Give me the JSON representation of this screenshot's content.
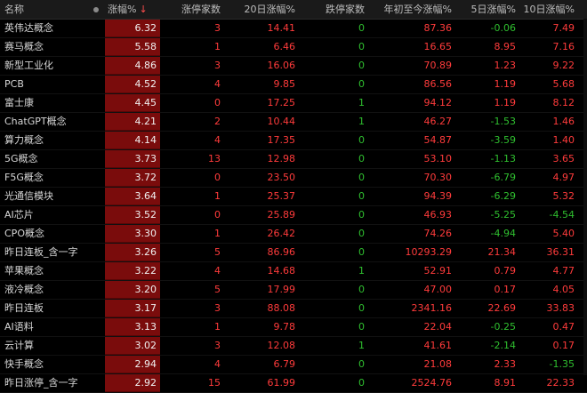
{
  "header": {
    "name": "名称",
    "pct": "涨幅%",
    "sort_icon": "↓",
    "limit_up": "涨停家数",
    "d20": "20日涨幅%",
    "limit_down": "跌停家数",
    "ytd": "年初至今涨幅%",
    "d5": "5日涨幅%",
    "d10": "10日涨幅%"
  },
  "colors": {
    "up": "#ff3b3b",
    "down": "#2fbf2f",
    "pct_bg": "#7a0c0c"
  },
  "rows": [
    {
      "name": "英伟达概念",
      "pct": "6.32",
      "limit_up": "3",
      "d20": "14.41",
      "limit_down": "0",
      "ytd": "87.36",
      "d5": "-0.06",
      "d10": "7.49"
    },
    {
      "name": "赛马概念",
      "pct": "5.58",
      "limit_up": "1",
      "d20": "6.46",
      "limit_down": "0",
      "ytd": "16.65",
      "d5": "8.95",
      "d10": "7.16"
    },
    {
      "name": "新型工业化",
      "pct": "4.86",
      "limit_up": "3",
      "d20": "16.06",
      "limit_down": "0",
      "ytd": "70.89",
      "d5": "1.23",
      "d10": "9.22"
    },
    {
      "name": "PCB",
      "pct": "4.52",
      "limit_up": "4",
      "d20": "9.85",
      "limit_down": "0",
      "ytd": "86.56",
      "d5": "1.19",
      "d10": "5.68"
    },
    {
      "name": "富士康",
      "pct": "4.45",
      "limit_up": "0",
      "d20": "17.25",
      "limit_down": "1",
      "ytd": "94.12",
      "d5": "1.19",
      "d10": "8.12"
    },
    {
      "name": "ChatGPT概念",
      "pct": "4.21",
      "limit_up": "2",
      "d20": "10.44",
      "limit_down": "1",
      "ytd": "46.27",
      "d5": "-1.53",
      "d10": "1.46"
    },
    {
      "name": "算力概念",
      "pct": "4.14",
      "limit_up": "4",
      "d20": "17.35",
      "limit_down": "0",
      "ytd": "54.87",
      "d5": "-3.59",
      "d10": "1.40"
    },
    {
      "name": "5G概念",
      "pct": "3.73",
      "limit_up": "13",
      "d20": "12.98",
      "limit_down": "0",
      "ytd": "53.10",
      "d5": "-1.13",
      "d10": "3.65"
    },
    {
      "name": "F5G概念",
      "pct": "3.72",
      "limit_up": "0",
      "d20": "23.50",
      "limit_down": "0",
      "ytd": "70.30",
      "d5": "-6.79",
      "d10": "4.97"
    },
    {
      "name": "光通信模块",
      "pct": "3.64",
      "limit_up": "1",
      "d20": "25.37",
      "limit_down": "0",
      "ytd": "94.39",
      "d5": "-6.29",
      "d10": "5.32"
    },
    {
      "name": "AI芯片",
      "pct": "3.52",
      "limit_up": "0",
      "d20": "25.89",
      "limit_down": "0",
      "ytd": "46.93",
      "d5": "-5.25",
      "d10": "-4.54"
    },
    {
      "name": "CPO概念",
      "pct": "3.30",
      "limit_up": "1",
      "d20": "26.42",
      "limit_down": "0",
      "ytd": "74.26",
      "d5": "-4.94",
      "d10": "5.40"
    },
    {
      "name": "昨日连板_含一字",
      "pct": "3.26",
      "limit_up": "5",
      "d20": "86.96",
      "limit_down": "0",
      "ytd": "10293.29",
      "d5": "21.34",
      "d10": "36.31"
    },
    {
      "name": "苹果概念",
      "pct": "3.22",
      "limit_up": "4",
      "d20": "14.68",
      "limit_down": "1",
      "ytd": "52.91",
      "d5": "0.79",
      "d10": "4.77"
    },
    {
      "name": "液冷概念",
      "pct": "3.20",
      "limit_up": "5",
      "d20": "17.99",
      "limit_down": "0",
      "ytd": "47.00",
      "d5": "0.17",
      "d10": "4.05"
    },
    {
      "name": "昨日连板",
      "pct": "3.17",
      "limit_up": "3",
      "d20": "88.08",
      "limit_down": "0",
      "ytd": "2341.16",
      "d5": "22.69",
      "d10": "33.83"
    },
    {
      "name": "AI语料",
      "pct": "3.13",
      "limit_up": "1",
      "d20": "9.78",
      "limit_down": "0",
      "ytd": "22.04",
      "d5": "-0.25",
      "d10": "0.47"
    },
    {
      "name": "云计算",
      "pct": "3.02",
      "limit_up": "3",
      "d20": "12.08",
      "limit_down": "1",
      "ytd": "41.61",
      "d5": "-2.14",
      "d10": "0.17"
    },
    {
      "name": "快手概念",
      "pct": "2.94",
      "limit_up": "4",
      "d20": "6.79",
      "limit_down": "0",
      "ytd": "21.08",
      "d5": "2.33",
      "d10": "-1.35"
    },
    {
      "name": "昨日涨停_含一字",
      "pct": "2.92",
      "limit_up": "15",
      "d20": "61.99",
      "limit_down": "0",
      "ytd": "2524.76",
      "d5": "8.91",
      "d10": "22.33"
    }
  ]
}
